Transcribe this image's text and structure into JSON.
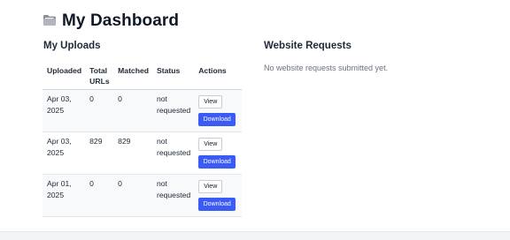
{
  "header": {
    "title": "My Dashboard",
    "icon": "folder-icon"
  },
  "uploads": {
    "title": "My Uploads",
    "columns": [
      "Uploaded",
      "Total URLs",
      "Matched",
      "Status",
      "Actions"
    ],
    "rows": [
      {
        "uploaded": "Apr 03, 2025",
        "total": "0",
        "matched": "0",
        "status": "not requested",
        "view_label": "View",
        "download_label": "Download"
      },
      {
        "uploaded": "Apr 03, 2025",
        "total": "829",
        "matched": "829",
        "status": "not requested",
        "view_label": "View",
        "download_label": "Download"
      },
      {
        "uploaded": "Apr 01, 2025",
        "total": "0",
        "matched": "0",
        "status": "not requested",
        "view_label": "View",
        "download_label": "Download"
      }
    ]
  },
  "requests": {
    "title": "Website Requests",
    "empty_text": "No website requests submitted yet."
  },
  "colors": {
    "primary_button": "#3b5bf5",
    "muted_text": "#6b7280"
  }
}
